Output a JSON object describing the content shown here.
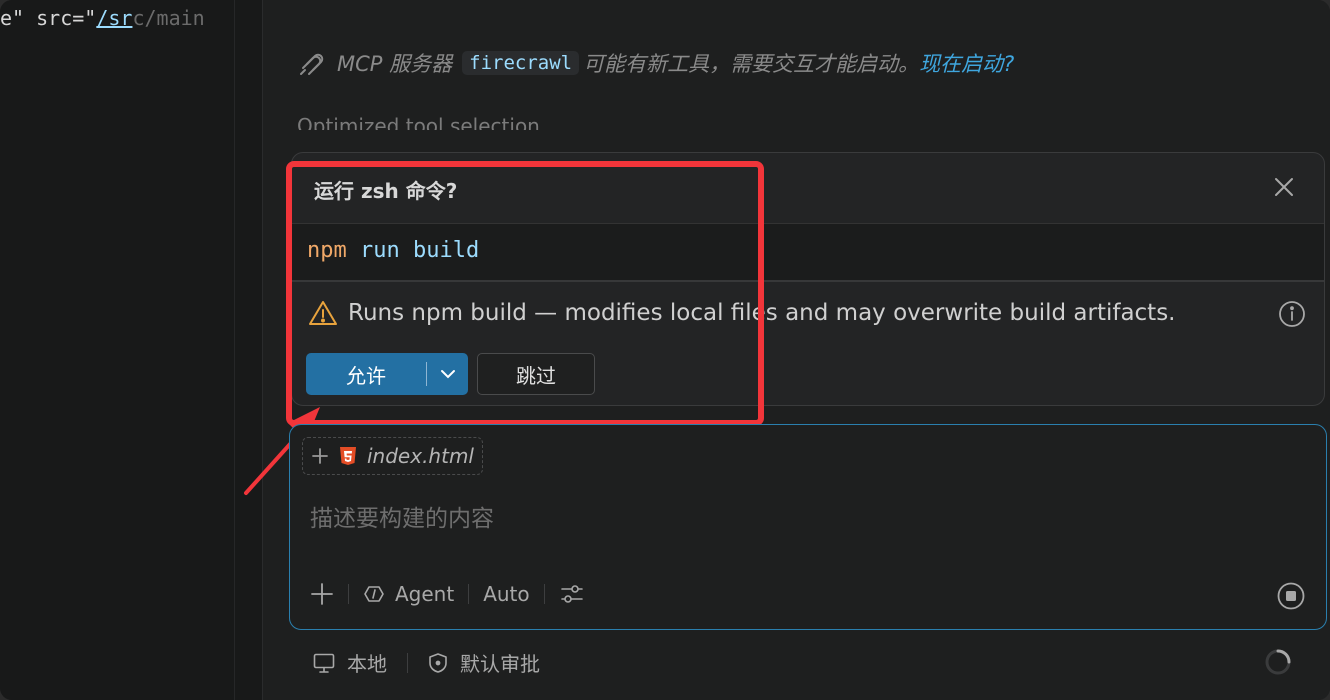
{
  "editor": {
    "code_line": {
      "part1": "e\" src=\"",
      "part2": "/sr",
      "part3": "c/main"
    }
  },
  "mcp_notice": {
    "prefix": "MCP 服务器",
    "server": "firecrawl",
    "message": "可能有新工具，需要交互才能启动。",
    "link": "现在启动?"
  },
  "faded_line": "Optimized tool selection",
  "run_card": {
    "title": "运行 zsh 命令?",
    "command": [
      "npm",
      "run",
      "build"
    ],
    "warning": "Runs npm build — modifies local files and may overwrite build artifacts.",
    "allow_label": "允许",
    "skip_label": "跳过"
  },
  "composer": {
    "file_chip": "index.html",
    "placeholder": "描述要构建的内容",
    "mode_label": "Agent",
    "model_label": "Auto"
  },
  "footer": {
    "local_label": "本地",
    "approval_label": "默认审批"
  },
  "colors": {
    "accent": "#2370a3",
    "link": "#3fa6de",
    "annotation": "#f2353a",
    "warning": "#e8a33d"
  }
}
